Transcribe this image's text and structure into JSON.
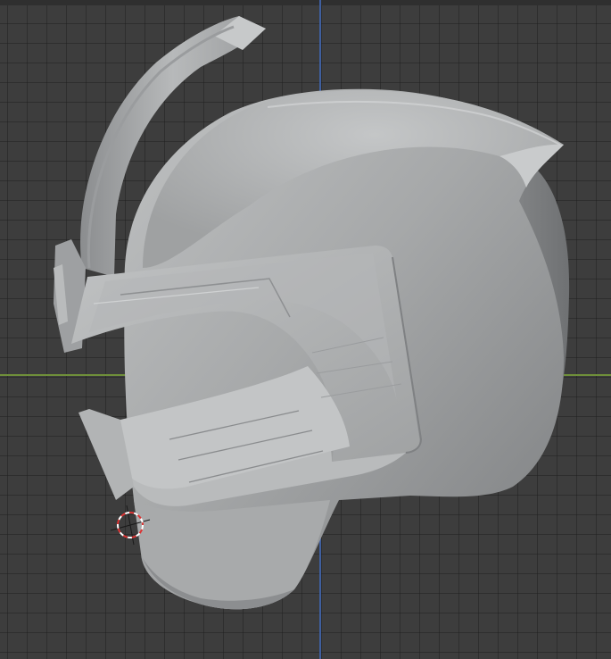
{
  "viewport": {
    "name": "3D Viewport",
    "background_color": "#3d3d3d",
    "grid_color": "#2a2a2a",
    "x_axis_color": "#6f8f3a",
    "y_axis_color": "#3f5f9f"
  },
  "object": {
    "name": "helmet-model",
    "material_color": "#a7a9aa",
    "shading": "solid"
  },
  "cursor": {
    "name": "3d-cursor",
    "colors": [
      "#d33",
      "#ffffff"
    ]
  }
}
